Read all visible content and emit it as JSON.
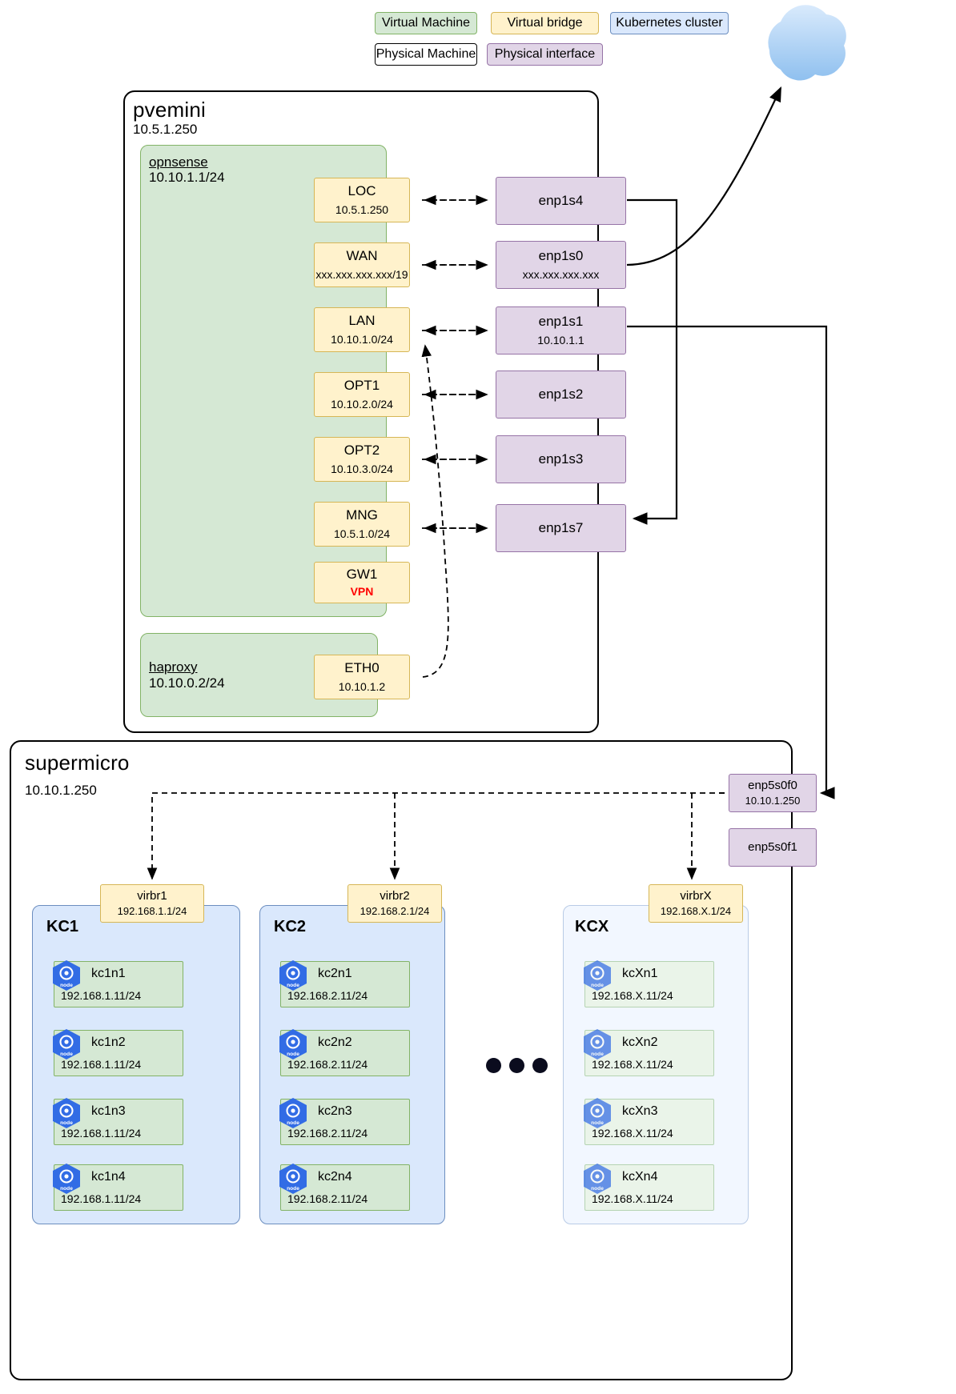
{
  "legend": {
    "items": [
      {
        "label": "Virtual Machine",
        "kind": "vm",
        "color": "#d5e8d4"
      },
      {
        "label": "Virtual bridge",
        "kind": "bridge",
        "color": "#fff2cc"
      },
      {
        "label": "Kubernetes cluster",
        "kind": "cluster",
        "color": "#dae8fc"
      },
      {
        "label": "Physical Machine",
        "kind": "machine",
        "color": "#ffffff"
      },
      {
        "label": "Physical interface",
        "kind": "iface",
        "color": "#e1d5e7"
      }
    ]
  },
  "cloud": {
    "name": "internet-cloud",
    "color": "#a9ccf0"
  },
  "pvemini": {
    "title": "pvemini",
    "ip": "10.5.1.250",
    "opnsense": {
      "name": "opnsense",
      "ip": "10.10.1.1/24",
      "bridges": [
        {
          "name": "LOC",
          "ip": "10.5.1.250"
        },
        {
          "name": "WAN",
          "ip": "xxx.xxx.xxx.xxx/19"
        },
        {
          "name": "LAN",
          "ip": "10.10.1.0/24"
        },
        {
          "name": "OPT1",
          "ip": "10.10.2.0/24"
        },
        {
          "name": "OPT2",
          "ip": "10.10.3.0/24"
        },
        {
          "name": "MNG",
          "ip": "10.5.1.0/24"
        },
        {
          "name": "GW1",
          "ip": "VPN",
          "ip_is_vpn": true
        }
      ]
    },
    "haproxy": {
      "name": "haproxy",
      "ip": "10.10.0.2/24",
      "bridge": {
        "name": "ETH0",
        "ip": "10.10.1.2"
      }
    },
    "interfaces": [
      {
        "name": "enp1s4",
        "ip": ""
      },
      {
        "name": "enp1s0",
        "ip": "xxx.xxx.xxx.xxx"
      },
      {
        "name": "enp1s1",
        "ip": "10.10.1.1"
      },
      {
        "name": "enp1s2",
        "ip": ""
      },
      {
        "name": "enp1s3",
        "ip": ""
      },
      {
        "name": "enp1s7",
        "ip": ""
      }
    ]
  },
  "supermicro": {
    "title": "supermicro",
    "ip": "10.10.1.250",
    "interfaces": [
      {
        "name": "enp5s0f0",
        "ip": "10.10.1.250"
      },
      {
        "name": "enp5s0f1",
        "ip": ""
      }
    ],
    "clusters": [
      {
        "label": "KC1",
        "bridge": {
          "name": "virbr1",
          "ip": "192.168.1.1/24"
        },
        "nodes": [
          {
            "name": "kc1n1",
            "ip": "192.168.1.11/24"
          },
          {
            "name": "kc1n2",
            "ip": "192.168.1.11/24"
          },
          {
            "name": "kc1n3",
            "ip": "192.168.1.11/24"
          },
          {
            "name": "kc1n4",
            "ip": "192.168.1.11/24"
          }
        ]
      },
      {
        "label": "KC2",
        "bridge": {
          "name": "virbr2",
          "ip": "192.168.2.1/24"
        },
        "nodes": [
          {
            "name": "kc2n1",
            "ip": "192.168.2.11/24"
          },
          {
            "name": "kc2n2",
            "ip": "192.168.2.11/24"
          },
          {
            "name": "kc2n3",
            "ip": "192.168.2.11/24"
          },
          {
            "name": "kc2n4",
            "ip": "192.168.2.11/24"
          }
        ]
      },
      {
        "label": "KCX",
        "bridge": {
          "name": "virbrX",
          "ip": "192.168.X.1/24"
        },
        "nodes": [
          {
            "name": "kcXn1",
            "ip": "192.168.X.11/24"
          },
          {
            "name": "kcXn2",
            "ip": "192.168.X.11/24"
          },
          {
            "name": "kcXn3",
            "ip": "192.168.X.11/24"
          },
          {
            "name": "kcXn4",
            "ip": "192.168.X.11/24"
          }
        ]
      }
    ],
    "ellipsis": "•••"
  },
  "node_icon_label": "node"
}
